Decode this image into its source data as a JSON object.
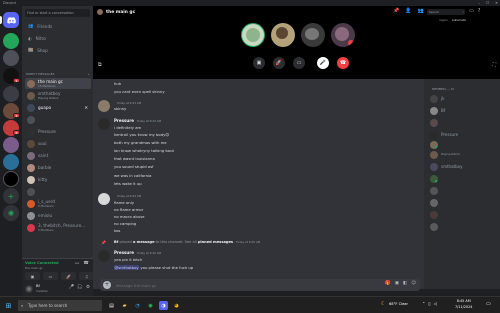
{
  "app": {
    "title": "Discord"
  },
  "window_controls": [
    "–",
    "☐",
    "✕"
  ],
  "guilds": {
    "colors": {
      "discord_blue": "#5865f2",
      "server_red": "#f23f43",
      "green": "#23a55a"
    },
    "badges": [
      "1",
      "4",
      "6",
      "1",
      "3"
    ]
  },
  "sidebar": {
    "search_placeholder": "Find or start a conversation",
    "nav": [
      {
        "label": "Friends",
        "icon": "friends-icon"
      },
      {
        "label": "Nitro",
        "icon": "nitro-icon"
      },
      {
        "label": "Shop",
        "icon": "shop-icon"
      }
    ],
    "dm_header": "DIRECT MESSAGES",
    "dm_add": "+",
    "dms": [
      {
        "name": "the main gc",
        "sub": "15 Members",
        "active": true
      },
      {
        "name": "smthatboy",
        "sub": "Playing Roblox"
      },
      {
        "name": "guapo",
        "sub": ""
      },
      {
        "name": "",
        "sub": ""
      },
      {
        "name": "Pressure",
        "sub": ""
      },
      {
        "name": "soul",
        "sub": ""
      },
      {
        "name": "saint",
        "sub": ""
      },
      {
        "name": "barbie",
        "sub": ""
      },
      {
        "name": "kitty",
        "sub": ""
      },
      {
        "name": "",
        "sub": ""
      },
      {
        "name": "i_s_uerd",
        "sub": "5 Members"
      },
      {
        "name": "emiolu",
        "sub": ""
      },
      {
        "name": "3, thebitch, Pressure...",
        "sub": "5 Members"
      }
    ]
  },
  "voice": {
    "status": "Voice Connected",
    "channel": "the main gc"
  },
  "user": {
    "name": "Bf",
    "status": "Invisible"
  },
  "call": {
    "channel_name": "the main gc",
    "search_placeholder": "Search",
    "region_label": "region",
    "region_value": "Automatic"
  },
  "chat": {
    "top_lines": [
      "huh",
      "you cant even spell skinny"
    ],
    "messages": [
      {
        "author": "",
        "timestamp": "Today at 9:43 AM",
        "lines": [
          "skinny"
        ]
      },
      {
        "author": "Pressure",
        "timestamp": "Today at 9:43 AM",
        "lines": [
          "i definitely am",
          "kentroll you know my body😊",
          "both my grandmas with me",
          "ion know whotryny talking bout",
          "that wasnt louisianna",
          "you sound stupid asf",
          "we was in california",
          "lets wake it up"
        ]
      },
      {
        "author": "",
        "timestamp": "Today at 9:44 AM",
        "lines": [
          "flame only",
          "no flame armor",
          "no macro abuse",
          "no camping",
          "kos"
        ]
      }
    ],
    "system": {
      "actor": "Bf",
      "text_before": " pinned ",
      "link1": "a message",
      "text_mid": " to this channel. See all ",
      "link2": "pinned messages",
      "timestamp": "Today at 9:45 AM"
    },
    "last": {
      "author": "Pressure",
      "timestamp": "Today at 9:45 AM",
      "line1": "yea pin it bitch",
      "mention": "@smthatboy",
      "line2_rest": " you please shut the fuck up"
    },
    "composer_placeholder": "Message the main gc"
  },
  "members": {
    "header": "MEMBERS — 15",
    "list": [
      {
        "name": "jk",
        "sub": ""
      },
      {
        "name": "Bf",
        "sub": ""
      },
      {
        "name": "",
        "sub": ""
      },
      {
        "name": "Pressure",
        "sub": ""
      },
      {
        "name": "",
        "sub": ""
      },
      {
        "name": "",
        "sub": "Playing Roblox"
      },
      {
        "name": "smthatboy",
        "sub": ""
      },
      {
        "name": "",
        "sub": ""
      },
      {
        "name": "",
        "sub": ""
      },
      {
        "name": "",
        "sub": ""
      },
      {
        "name": "",
        "sub": ""
      },
      {
        "name": "",
        "sub": ""
      }
    ]
  },
  "taskbar": {
    "search_placeholder": "Type here to search",
    "weather": "68°F  Clear",
    "time": "8:45 AM",
    "date": "7/11/2024"
  }
}
